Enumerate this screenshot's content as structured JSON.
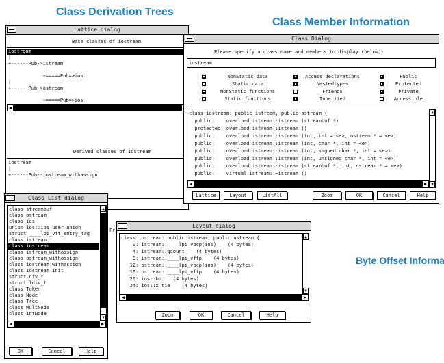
{
  "captions": {
    "trees": "Class Derivation Trees",
    "members": "Class Member Information",
    "offsets": "Byte Offset Informatio"
  },
  "lattice": {
    "title": "Lattice dialog",
    "base_heading": "Base classes of iostream",
    "base_lines": [
      "iostream",
      "|",
      "+------Pub->istream",
      "            |",
      "            +=====Pub=>ios",
      "|",
      "+------Pub->ostream",
      "            |",
      "            +=====Pub=>ios"
    ],
    "derived_heading": "Derived classes of iostream",
    "derived_lines": [
      "iostream",
      "|",
      "+------Pub--iostream_withassign"
    ]
  },
  "class_dialog": {
    "title": "Class Dialog",
    "prompt": "Please specify a class name and members to display (below):",
    "class_name_value": "iostream",
    "options_col1": [
      "NonStatic data",
      "Static data",
      "NonStatic functions",
      "Static functions"
    ],
    "options_col2": [
      "Access declarations",
      "Nestedtypes",
      "Friends",
      "Inherited"
    ],
    "options_col3": [
      "Public",
      "Protected",
      "Private",
      "Accessible"
    ],
    "listing": [
      "class iostream: public istream, public ostream {",
      "  public:    overload istream::istream (streambuf *)",
      "  protected: overload istream::istream ()",
      "  public:    overload istream::istream (int, int = <e>, ostream * = <e>)",
      "  public:    overload istream::istream (int, char *, int = <e>)",
      "  public:    overload istream::istream (int, signed char *, int = <e>)",
      "  public:    overload istream::istream (int, unsigned char *, int = <e>)",
      "  public:    overload istream::istream (streambuf *, int, ostream * = <e>)",
      "  public:    virtual istream::~istream ()"
    ],
    "buttons": {
      "lattice": "Lattice",
      "layout": "Layout",
      "listall": "ListAll",
      "zoom": "Zoom",
      "ok": "OK",
      "cancel": "Cancel",
      "help": "Help"
    }
  },
  "class_list": {
    "title": "Class List dialog",
    "items": [
      "class streambuf",
      "class ostream",
      "class ios",
      "union ios::ios_user_union",
      "struct ____lpi_vft_entry_tag",
      "class istream",
      "class iostream",
      "class istream_withassign",
      "class ostream_withassign",
      "class iostream_withassign",
      "class Iostream_init",
      "struct div_t",
      "struct ldiv_t",
      "class Token",
      "class Node",
      "class Tree",
      "class MultNode",
      "class IntNode"
    ],
    "selected_index": 6,
    "buttons": {
      "ok": "OK",
      "cancel": "Cancel",
      "help": "Help"
    }
  },
  "layout_dialog": {
    "title": "Layout dialog",
    "partial_label": "Fr",
    "lines": [
      "class iostream: public istream, public ostream {",
      "    0: istream::____lpi_vbcp(ios)    (4 bytes)",
      "    4: istream::gcount_   (4 bytes)",
      "    8: istream::____lpi_vftp    (4 bytes)",
      "   12: ostream::____lpi_vbcp(ios)    (4 bytes)",
      "   16: ostream::____lpi_vftp    (4 bytes)",
      "   20: ios::bp    (4 bytes)",
      "   24: ios::x_tie    (4 bytes)"
    ],
    "buttons": {
      "zoom": "Zoom",
      "ok": "OK",
      "cancel": "Cancel",
      "help": "Help"
    }
  }
}
